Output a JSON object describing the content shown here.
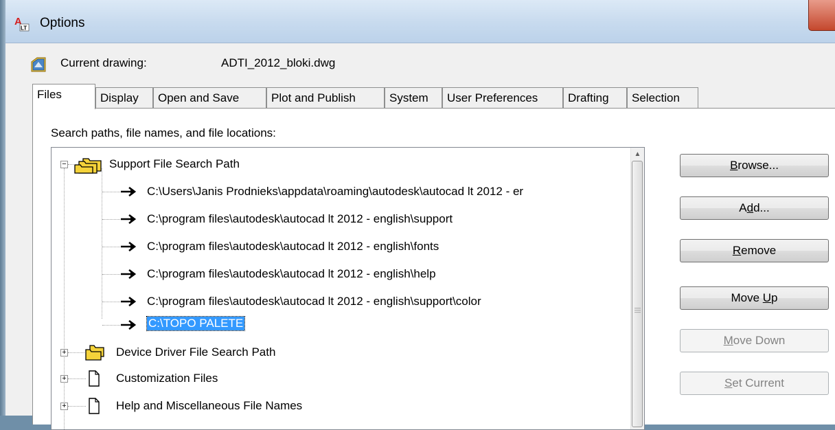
{
  "window": {
    "title": "Options"
  },
  "current_drawing": {
    "label": "Current drawing:",
    "value": "ADTI_2012_bloki.dwg"
  },
  "tabs": [
    {
      "label": "Files",
      "active": true
    },
    {
      "label": "Display",
      "active": false
    },
    {
      "label": "Open and Save",
      "active": false
    },
    {
      "label": "Plot and Publish",
      "active": false
    },
    {
      "label": "System",
      "active": false
    },
    {
      "label": "User Preferences",
      "active": false
    },
    {
      "label": "Drafting",
      "active": false
    },
    {
      "label": "Selection",
      "active": false
    }
  ],
  "files_tab": {
    "section_label": "Search paths, file names, and file locations:",
    "tree": {
      "support": {
        "label": "Support File Search Path",
        "expander": "−",
        "paths": [
          "C:\\Users\\Janis Prodnieks\\appdata\\roaming\\autodesk\\autocad lt 2012 - er",
          "C:\\program files\\autodesk\\autocad lt 2012 - english\\support",
          "C:\\program files\\autodesk\\autocad lt 2012 - english\\fonts",
          "C:\\program files\\autodesk\\autocad lt 2012 - english\\help",
          "C:\\program files\\autodesk\\autocad lt 2012 - english\\support\\color",
          "C:\\TOPO PALETE"
        ],
        "selected_index": 5
      },
      "device_driver": {
        "label": "Device Driver File Search Path",
        "expander": "+"
      },
      "customization": {
        "label": "Customization Files",
        "expander": "+"
      },
      "help_misc": {
        "label": "Help and Miscellaneous File Names",
        "expander": "+"
      }
    },
    "buttons": {
      "browse": {
        "pre": "",
        "mnemonic": "B",
        "post": "rowse..."
      },
      "add": {
        "pre": "A",
        "mnemonic": "d",
        "post": "d..."
      },
      "remove": {
        "pre": "",
        "mnemonic": "R",
        "post": "emove"
      },
      "move_up": {
        "pre": "Move ",
        "mnemonic": "U",
        "post": "p"
      },
      "move_down": {
        "pre": "",
        "mnemonic": "M",
        "post": "ove Down"
      },
      "set_current": {
        "pre": "",
        "mnemonic": "S",
        "post": "et Current"
      }
    }
  },
  "colors": {
    "selection": "#3399ff",
    "title_gradient_top": "#dce9f6",
    "close_red": "#c4472d",
    "folder_yellow": "#f5d33a"
  }
}
